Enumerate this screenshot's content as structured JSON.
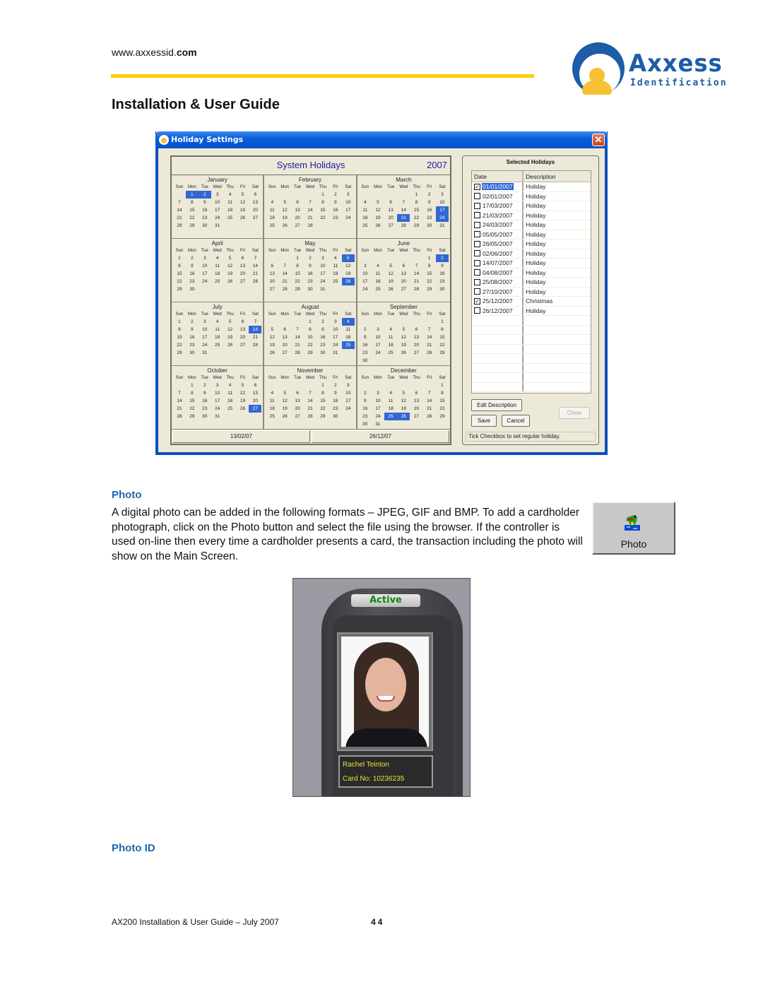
{
  "header": {
    "url_prefix": "www.axxessid.",
    "url_suffix": "com",
    "doc_title": "Installation & User Guide",
    "logo": {
      "brand": "Axxess",
      "sub": "Identification",
      "brand_color": "#1d5ca6",
      "accent_color": "#f7c136"
    }
  },
  "window": {
    "title": "Holiday Settings",
    "close_glyph": "✕",
    "calendar": {
      "title": "System Holidays",
      "year": "2007",
      "weekday_headers": [
        "Sun",
        "Mon",
        "Tue",
        "Wed",
        "Thu",
        "Fri",
        "Sat"
      ],
      "months": [
        {
          "name": "January",
          "first_weekday": 1,
          "days": 31,
          "selected": [
            1,
            2
          ]
        },
        {
          "name": "February",
          "first_weekday": 4,
          "days": 28,
          "selected": []
        },
        {
          "name": "March",
          "first_weekday": 4,
          "days": 31,
          "selected": [
            17,
            21,
            24
          ]
        },
        {
          "name": "April",
          "first_weekday": 0,
          "days": 30,
          "selected": []
        },
        {
          "name": "May",
          "first_weekday": 2,
          "days": 31,
          "selected": [
            5,
            26
          ]
        },
        {
          "name": "June",
          "first_weekday": 5,
          "days": 30,
          "selected": [
            2
          ]
        },
        {
          "name": "July",
          "first_weekday": 0,
          "days": 31,
          "selected": [
            14
          ]
        },
        {
          "name": "August",
          "first_weekday": 3,
          "days": 31,
          "selected": [
            4,
            25
          ]
        },
        {
          "name": "September",
          "first_weekday": 6,
          "days": 30,
          "selected": []
        },
        {
          "name": "October",
          "first_weekday": 1,
          "days": 31,
          "selected": [
            27
          ]
        },
        {
          "name": "November",
          "first_weekday": 4,
          "days": 30,
          "selected": []
        },
        {
          "name": "December",
          "first_weekday": 6,
          "days": 31,
          "selected": [
            25,
            26
          ]
        }
      ],
      "footer_left": "13/02/07",
      "footer_right": "26/12/07"
    },
    "selected_holidays": {
      "title": "Selected Holidays",
      "columns": [
        "Date",
        "Description"
      ],
      "rows": [
        {
          "date": "01/01/2007",
          "description": "Holiday",
          "checked": true,
          "active": true
        },
        {
          "date": "02/01/2007",
          "description": "Holiday",
          "checked": false
        },
        {
          "date": "17/03/2007",
          "description": "Holiday",
          "checked": false
        },
        {
          "date": "21/03/2007",
          "description": "Holiday",
          "checked": false
        },
        {
          "date": "24/03/2007",
          "description": "Holiday",
          "checked": false
        },
        {
          "date": "05/05/2007",
          "description": "Holiday",
          "checked": false
        },
        {
          "date": "26/05/2007",
          "description": "Holiday",
          "checked": false
        },
        {
          "date": "02/06/2007",
          "description": "Holiday",
          "checked": false
        },
        {
          "date": "14/07/2007",
          "description": "Holiday",
          "checked": false
        },
        {
          "date": "04/08/2007",
          "description": "Holiday",
          "checked": false
        },
        {
          "date": "25/08/2007",
          "description": "Holiday",
          "checked": false
        },
        {
          "date": "27/10/2007",
          "description": "Holiday",
          "checked": false
        },
        {
          "date": "25/12/2007",
          "description": "Christmas",
          "checked": true
        },
        {
          "date": "26/12/2007",
          "description": "Holiday",
          "checked": false
        }
      ],
      "empty_rows": 8,
      "buttons": {
        "edit_description": "Edit Description",
        "save": "Save",
        "cancel": "Cancel",
        "close": "Close"
      },
      "status": "Tick Checkbox to set regular holiday."
    },
    "selection_color": "#3168d5"
  },
  "photo_section": {
    "heading": "Photo",
    "paragraph": "A digital photo can be added in the following formats – JPEG, GIF and BMP.  To add a cardholder photograph, click on the Photo button and select the file using the browser.  If the controller is used on-line then every time a cardholder presents a card, the transaction including the photo will show on the Main Screen.",
    "photo_button_label": "Photo"
  },
  "reader": {
    "status": "Active",
    "cardholder_name": "Rachel Teinton",
    "card_number": "Card No: 10236235"
  },
  "photo_id_section": {
    "heading": "Photo ID"
  },
  "footer": {
    "text": "AX200 Installation & User Guide – July 2007",
    "page": "44"
  }
}
